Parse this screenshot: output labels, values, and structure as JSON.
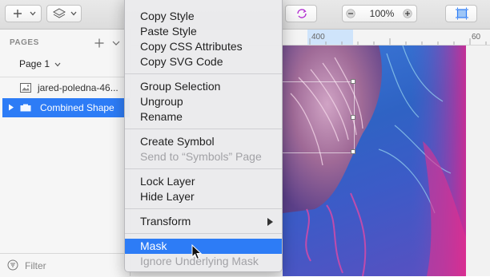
{
  "toolbar": {
    "zoom_value": "100%"
  },
  "sidebar": {
    "pages_header": "PAGES",
    "page_name": "Page 1",
    "layers": [
      {
        "label": "jared-poledna-46...",
        "selected": false
      },
      {
        "label": "Combined Shape",
        "selected": true
      }
    ],
    "filter_label": "Filter"
  },
  "ruler": {
    "tick_400": "400",
    "tick_600": "60"
  },
  "context_menu": {
    "items": [
      {
        "label": "Copy Style",
        "enabled": true
      },
      {
        "label": "Paste Style",
        "enabled": true
      },
      {
        "label": "Copy CSS Attributes",
        "enabled": true
      },
      {
        "label": "Copy SVG Code",
        "enabled": true
      },
      {
        "label": "Group Selection",
        "enabled": true
      },
      {
        "label": "Ungroup",
        "enabled": true
      },
      {
        "label": "Rename",
        "enabled": true
      },
      {
        "label": "Create Symbol",
        "enabled": true
      },
      {
        "label": "Send to “Symbols” Page",
        "enabled": false
      },
      {
        "label": "Lock Layer",
        "enabled": true
      },
      {
        "label": "Hide Layer",
        "enabled": true
      },
      {
        "label": "Transform",
        "enabled": true,
        "submenu": true
      },
      {
        "label": "Mask",
        "enabled": true,
        "highlighted": true
      },
      {
        "label": "Ignore Underlying Mask",
        "enabled": false
      }
    ]
  },
  "colors": {
    "selection_blue": "#2d7cf6",
    "menu_bg": "#eaeaec",
    "disabled_text": "#a2a2a6"
  }
}
